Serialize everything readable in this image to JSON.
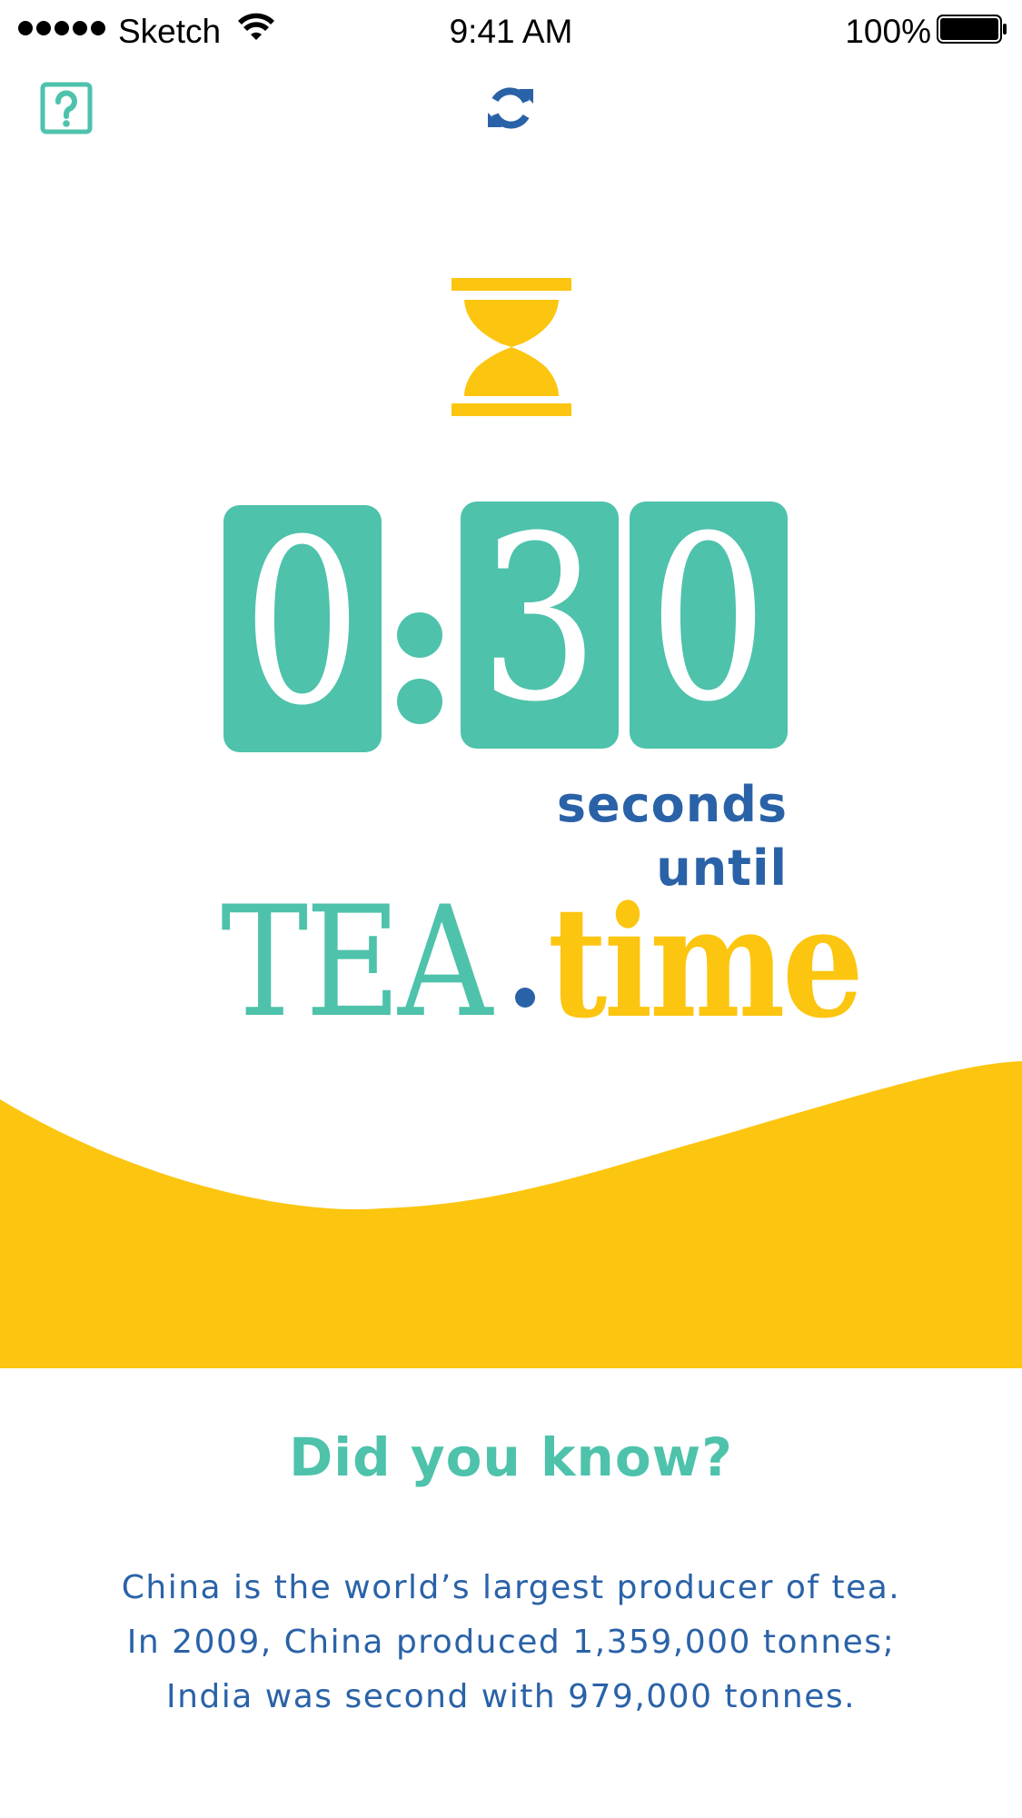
{
  "status_bar": {
    "carrier": "Sketch",
    "time": "9:41 AM",
    "battery_percent": "100%",
    "signal_bars": 5
  },
  "toolbar": {
    "help_icon": "question-square-icon",
    "refresh_icon": "refresh-icon"
  },
  "timer": {
    "minute": "0",
    "separator": ":",
    "second_tens": "3",
    "second_ones": "0",
    "unit_label": "seconds",
    "until_label": "until"
  },
  "brand": {
    "tea": "TEA",
    "time": "time"
  },
  "did_you_know": {
    "title": "Did you know?",
    "lines": [
      "China is the world’s largest producer of tea.",
      "In 2009, China produced 1,359,000 tonnes;",
      "India was second with 979,000 tonnes."
    ]
  },
  "colors": {
    "teal": "#4ec2ab",
    "yellow": "#fcc50f",
    "blue": "#2a62a8",
    "background": "#ffffff"
  }
}
